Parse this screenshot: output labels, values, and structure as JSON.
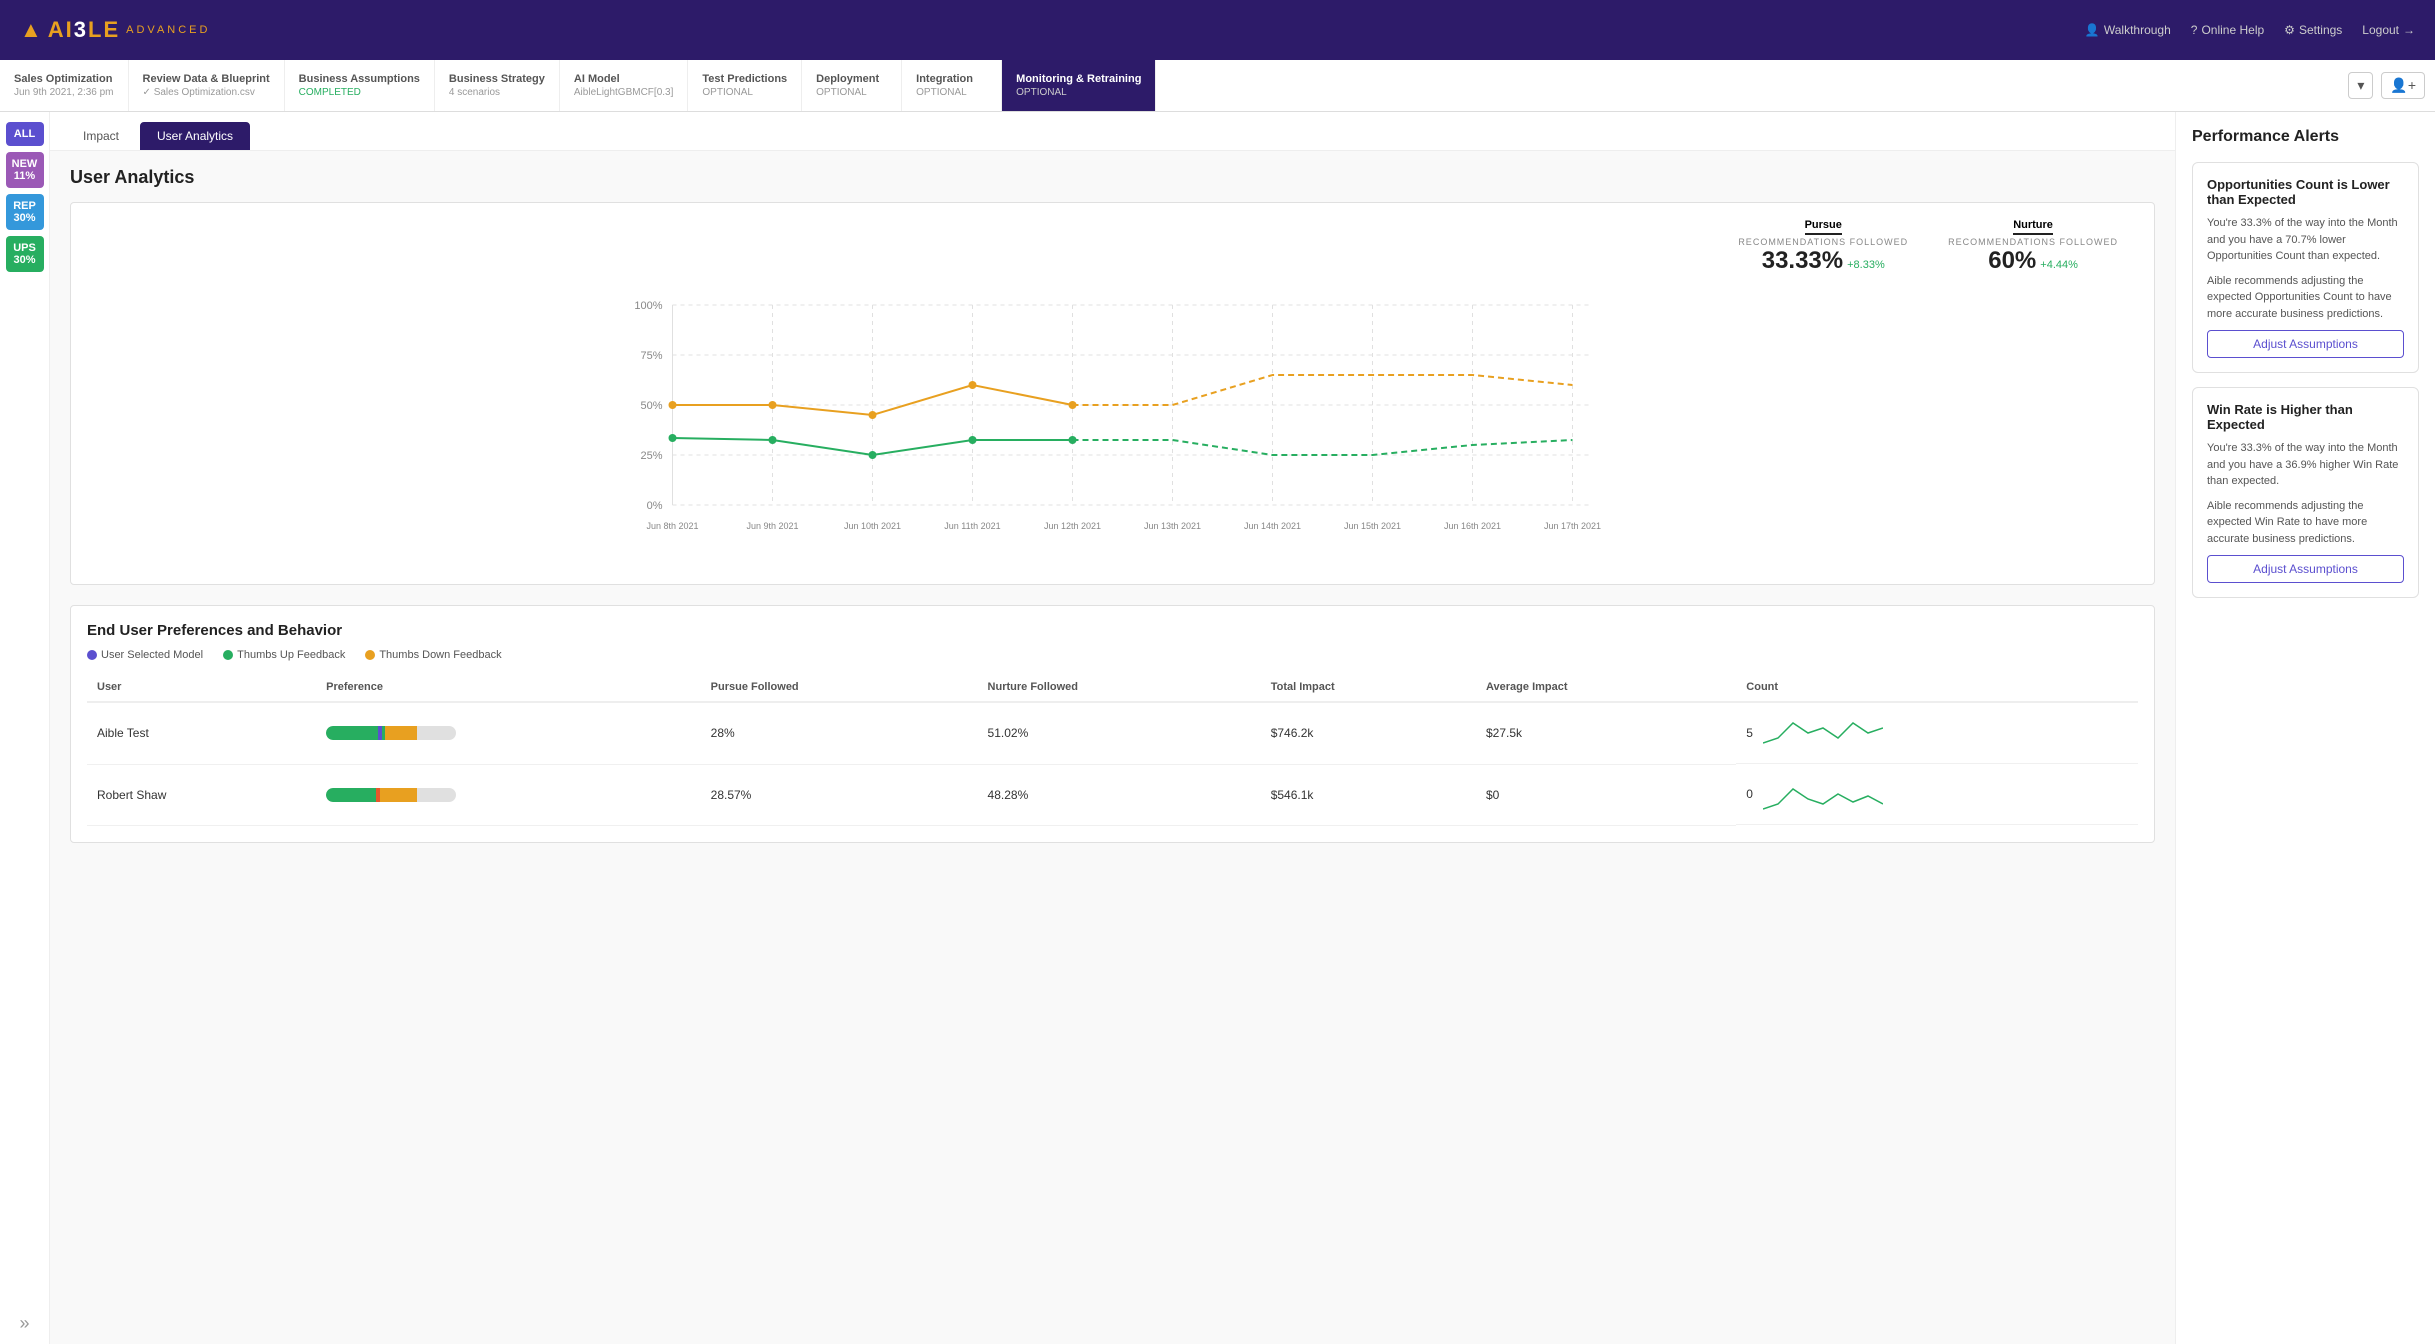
{
  "app": {
    "logo_text": "AI3LE",
    "logo_advanced": "ADVANCED"
  },
  "nav_actions": [
    {
      "id": "walkthrough",
      "label": "Walkthrough",
      "icon": "👤"
    },
    {
      "id": "online-help",
      "label": "Online Help",
      "icon": "?"
    },
    {
      "id": "settings",
      "label": "Settings",
      "icon": "⚙"
    },
    {
      "id": "logout",
      "label": "Logout",
      "icon": "→"
    }
  ],
  "tabs": [
    {
      "id": "sales-opt",
      "label": "Sales Optimization",
      "sub": "Jun 9th 2021, 2:36 pm",
      "status": "",
      "active": false
    },
    {
      "id": "review",
      "label": "Review Data & Blueprint",
      "sub": "Sales Optimization.csv",
      "status": "",
      "active": false
    },
    {
      "id": "business-assumptions",
      "label": "Business Assumptions",
      "sub": "COMPLETED",
      "status": "completed",
      "active": false
    },
    {
      "id": "business-strategy",
      "label": "Business Strategy",
      "sub": "4 scenarios",
      "status": "",
      "active": false
    },
    {
      "id": "ai-model",
      "label": "AI Model",
      "sub": "AibleLightGBMCF[0.3]",
      "status": "",
      "active": false
    },
    {
      "id": "test-predictions",
      "label": "Test Predictions",
      "sub": "OPTIONAL",
      "status": "optional",
      "active": false
    },
    {
      "id": "deployment",
      "label": "Deployment",
      "sub": "OPTIONAL",
      "status": "optional",
      "active": false
    },
    {
      "id": "integration",
      "label": "Integration",
      "sub": "OPTIONAL",
      "status": "optional",
      "active": false
    },
    {
      "id": "monitoring",
      "label": "Monitoring & Retraining",
      "sub": "OPTIONAL",
      "status": "optional",
      "active": true
    }
  ],
  "sidebar_pills": [
    {
      "id": "all",
      "label": "ALL",
      "class": "pill-all"
    },
    {
      "id": "new",
      "label": "NEW\n11%",
      "class": "pill-new"
    },
    {
      "id": "rep",
      "label": "REP\n30%",
      "class": "pill-rep"
    },
    {
      "id": "ups",
      "label": "UPS\n30%",
      "class": "pill-ups"
    }
  ],
  "sub_tabs": [
    {
      "id": "impact",
      "label": "Impact",
      "active": false
    },
    {
      "id": "user-analytics",
      "label": "User Analytics",
      "active": true
    }
  ],
  "section": {
    "title": "User Analytics"
  },
  "chart": {
    "pursue_label": "Pursue",
    "pursue_sub": "RECOMMENDATIONS FOLLOWED",
    "pursue_value": "33.33%",
    "pursue_change": "+8.33%",
    "nurture_label": "Nurture",
    "nurture_sub": "RECOMMENDATIONS FOLLOWED",
    "nurture_value": "60%",
    "nurture_change": "+4.44%",
    "x_labels": [
      "Jun 8th 2021",
      "Jun 9th 2021",
      "Jun 10th 2021",
      "Jun 11th 2021",
      "Jun 12th 2021",
      "Jun 13th 2021",
      "Jun 14th 2021",
      "Jun 15th 2021",
      "Jun 16th 2021",
      "Jun 17th 2021"
    ],
    "y_labels": [
      "100%",
      "75%",
      "50%",
      "25%",
      "0%"
    ]
  },
  "preferences": {
    "title": "End User Preferences and Behavior",
    "legend": [
      {
        "id": "user-selected",
        "label": "User Selected Model",
        "color": "#5b4fcf"
      },
      {
        "id": "thumbs-up",
        "label": "Thumbs Up Feedback",
        "color": "#27ae60"
      },
      {
        "id": "thumbs-down",
        "label": "Thumbs Down Feedback",
        "color": "#e8a020"
      }
    ],
    "columns": [
      "User",
      "Preference",
      "Pursue Followed",
      "Nurture Followed",
      "Total Impact",
      "Average Impact",
      "Count"
    ],
    "rows": [
      {
        "user": "Aible Test",
        "preference": {
          "green_pct": 0.45,
          "orange_pct": 0.25,
          "indicator_pos": 0.4
        },
        "pursue_followed": "28%",
        "nurture_followed": "51.02%",
        "total_impact": "$746.2k",
        "average_impact": "$27.5k",
        "count": "5"
      },
      {
        "user": "Robert Shaw",
        "preference": {
          "green_pct": 0.4,
          "orange_pct": 0.3,
          "indicator_pos": 0.38
        },
        "pursue_followed": "28.57%",
        "nurture_followed": "48.28%",
        "total_impact": "$546.1k",
        "average_impact": "$0",
        "count": "0"
      }
    ]
  },
  "performance_alerts": {
    "title": "Performance Alerts",
    "alerts": [
      {
        "id": "opportunities-count",
        "title": "Opportunities Count is Lower than Expected",
        "text1": "You're 33.3% of the way into the Month and you have a 70.7% lower Opportunities Count than expected.",
        "text2": "Aible recommends adjusting the expected Opportunities Count to have more accurate business predictions.",
        "btn_label": "Adjust Assumptions"
      },
      {
        "id": "win-rate",
        "title": "Win Rate is Higher than Expected",
        "text1": "You're 33.3% of the way into the Month and you have a 36.9% higher Win Rate than expected.",
        "text2": "Aible recommends adjusting the expected Win Rate to have more accurate business predictions.",
        "btn_label": "Adjust Assumptions"
      }
    ]
  }
}
